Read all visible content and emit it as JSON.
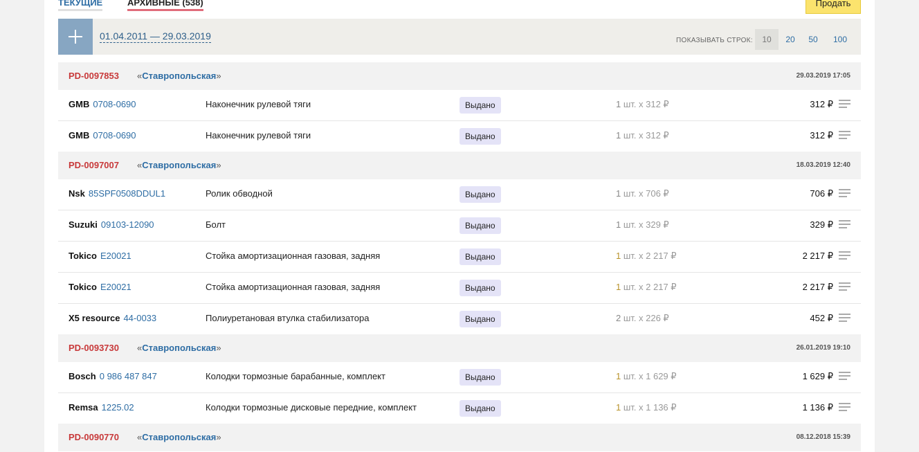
{
  "tabs": {
    "current": "ТЕКУЩИЕ",
    "archive": "АРХИВНЫЕ (538)"
  },
  "sell_button": "Продать",
  "filter": {
    "date_range": "01.04.2011 — 29.03.2019",
    "rows_label": "ПОКАЗЫВАТЬ СТРОК:",
    "rows_options": [
      "10",
      "20",
      "50",
      "100"
    ],
    "rows_selected": "10"
  },
  "orders": [
    {
      "id": "PD-0097853",
      "store": "Ставропольская",
      "date": "29.03.2019 17:05",
      "items": [
        {
          "brand": "GMB",
          "article": "0708-0690",
          "desc": "Наконечник рулевой тяги",
          "status": "Выдано",
          "qty": "1",
          "unit": "шт. x 312 ₽",
          "highlight": false,
          "price": "312 ₽"
        },
        {
          "brand": "GMB",
          "article": "0708-0690",
          "desc": "Наконечник рулевой тяги",
          "status": "Выдано",
          "qty": "1",
          "unit": "шт. x 312 ₽",
          "highlight": false,
          "price": "312 ₽"
        }
      ]
    },
    {
      "id": "PD-0097007",
      "store": "Ставропольская",
      "date": "18.03.2019 12:40",
      "items": [
        {
          "brand": "Nsk",
          "article": "85SPF0508DDUL1",
          "desc": "Ролик обводной",
          "status": "Выдано",
          "qty": "1",
          "unit": "шт. x 706 ₽",
          "highlight": false,
          "price": "706 ₽"
        },
        {
          "brand": "Suzuki",
          "article": "09103-12090",
          "desc": "Болт",
          "status": "Выдано",
          "qty": "1",
          "unit": "шт. x 329 ₽",
          "highlight": false,
          "price": "329 ₽"
        },
        {
          "brand": "Tokico",
          "article": "E20021",
          "desc": "Стойка амортизационная газовая, задняя",
          "status": "Выдано",
          "qty": "1",
          "unit": "шт. x 2 217 ₽",
          "highlight": true,
          "price": "2 217 ₽"
        },
        {
          "brand": "Tokico",
          "article": "E20021",
          "desc": "Стойка амортизационная газовая, задняя",
          "status": "Выдано",
          "qty": "1",
          "unit": "шт. x 2 217 ₽",
          "highlight": true,
          "price": "2 217 ₽"
        },
        {
          "brand": "X5 resource",
          "article": "44-0033",
          "desc": "Полиуретановая втулка стабилизатора",
          "status": "Выдано",
          "qty": "2",
          "unit": "шт. x 226 ₽",
          "highlight": false,
          "price": "452 ₽"
        }
      ]
    },
    {
      "id": "PD-0093730",
      "store": "Ставропольская",
      "date": "26.01.2019 19:10",
      "items": [
        {
          "brand": "Bosch",
          "article": "0 986 487 847",
          "desc": "Колодки тормозные барабанные, комплект",
          "status": "Выдано",
          "qty": "1",
          "unit": "шт. x 1 629 ₽",
          "highlight": true,
          "price": "1 629 ₽"
        },
        {
          "brand": "Remsa",
          "article": "1225.02",
          "desc": "Колодки тормозные дисковые передние, комплект",
          "status": "Выдано",
          "qty": "1",
          "unit": "шт. x 1 136 ₽",
          "highlight": true,
          "price": "1 136 ₽"
        }
      ]
    },
    {
      "id": "PD-0090770",
      "store": "Ставропольская",
      "date": "08.12.2018 15:39",
      "items": []
    }
  ]
}
